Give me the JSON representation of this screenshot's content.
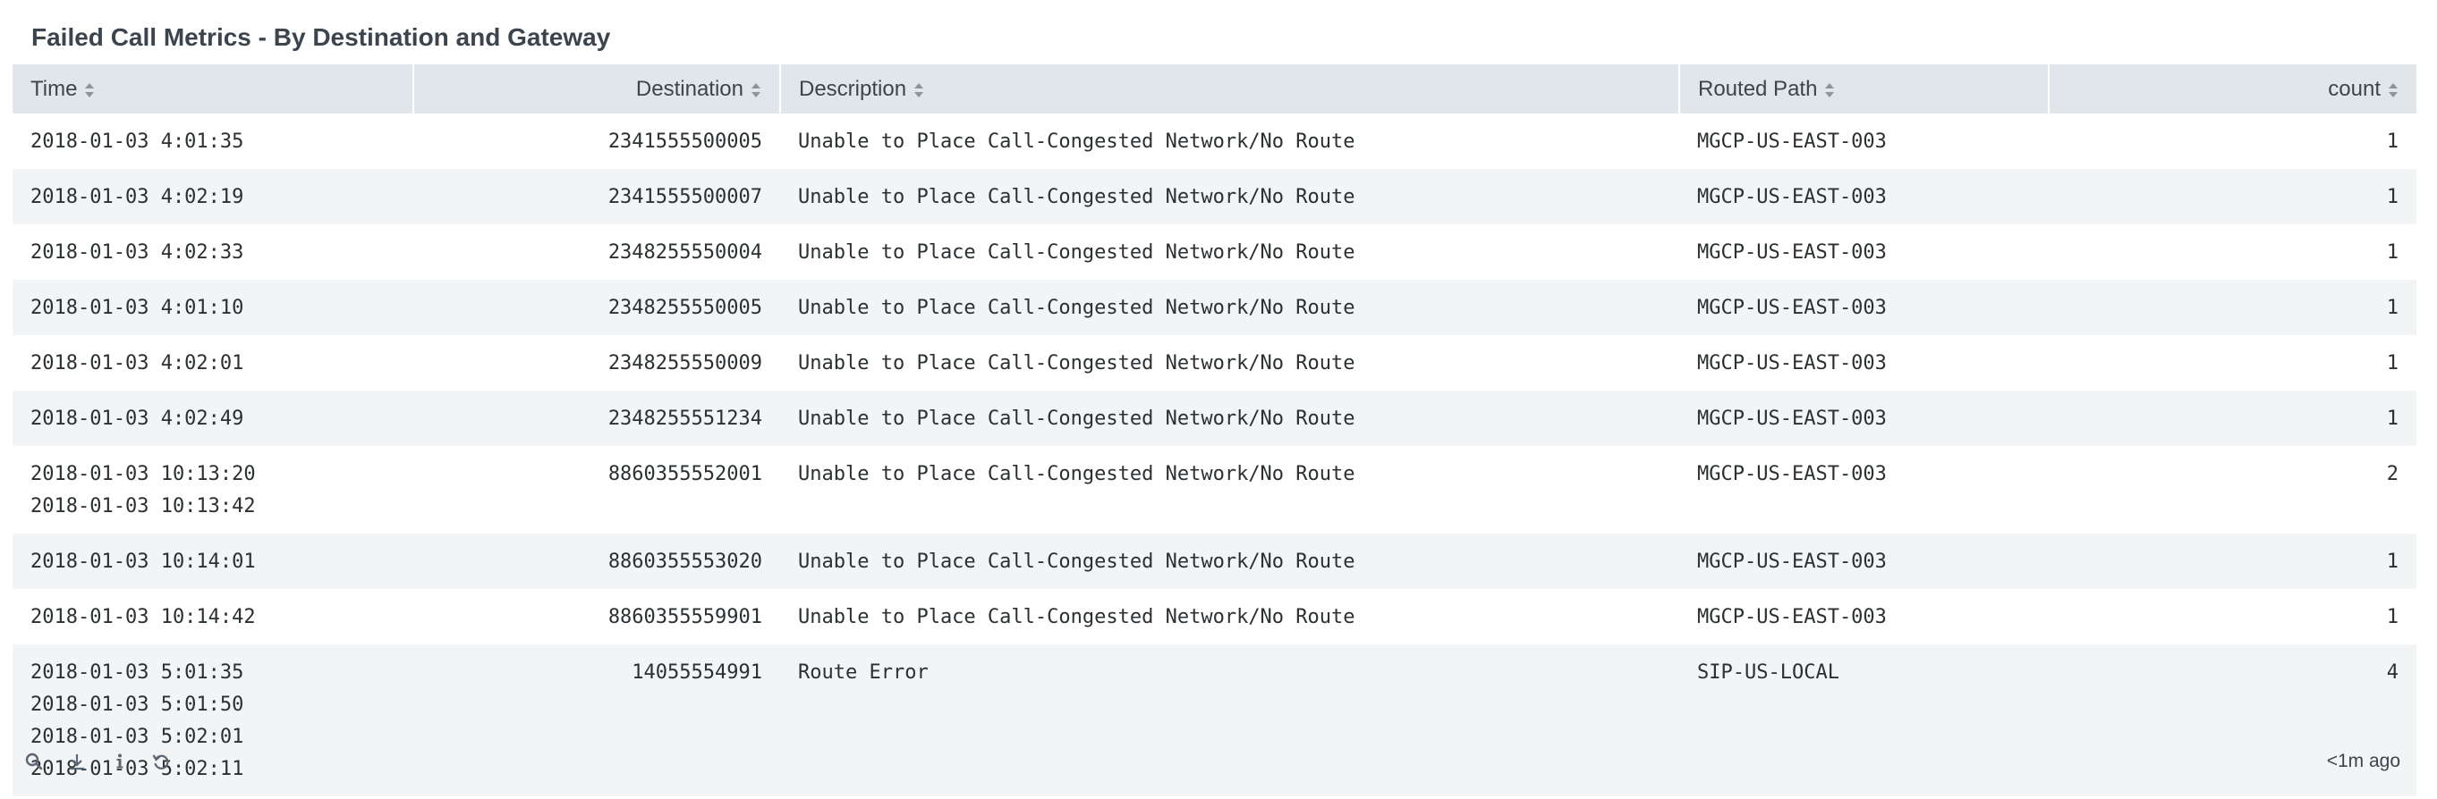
{
  "panel": {
    "title": "Failed Call Metrics - By Destination and Gateway"
  },
  "table": {
    "columns": [
      {
        "key": "time",
        "label": "Time",
        "align": "left"
      },
      {
        "key": "destination",
        "label": "Destination",
        "align": "right"
      },
      {
        "key": "description",
        "label": "Description",
        "align": "left"
      },
      {
        "key": "routed_path",
        "label": "Routed Path",
        "align": "left"
      },
      {
        "key": "count",
        "label": "count",
        "align": "right"
      }
    ],
    "rows": [
      {
        "time": [
          "2018-01-03 4:01:35"
        ],
        "destination": "2341555500005",
        "description": "Unable to Place Call-Congested Network/No Route",
        "routed_path": "MGCP-US-EAST-003",
        "count": "1"
      },
      {
        "time": [
          "2018-01-03 4:02:19"
        ],
        "destination": "2341555500007",
        "description": "Unable to Place Call-Congested Network/No Route",
        "routed_path": "MGCP-US-EAST-003",
        "count": "1"
      },
      {
        "time": [
          "2018-01-03 4:02:33"
        ],
        "destination": "2348255550004",
        "description": "Unable to Place Call-Congested Network/No Route",
        "routed_path": "MGCP-US-EAST-003",
        "count": "1"
      },
      {
        "time": [
          "2018-01-03 4:01:10"
        ],
        "destination": "2348255550005",
        "description": "Unable to Place Call-Congested Network/No Route",
        "routed_path": "MGCP-US-EAST-003",
        "count": "1"
      },
      {
        "time": [
          "2018-01-03 4:02:01"
        ],
        "destination": "2348255550009",
        "description": "Unable to Place Call-Congested Network/No Route",
        "routed_path": "MGCP-US-EAST-003",
        "count": "1"
      },
      {
        "time": [
          "2018-01-03 4:02:49"
        ],
        "destination": "2348255551234",
        "description": "Unable to Place Call-Congested Network/No Route",
        "routed_path": "MGCP-US-EAST-003",
        "count": "1"
      },
      {
        "time": [
          "2018-01-03 10:13:20",
          "2018-01-03 10:13:42"
        ],
        "destination": "8860355552001",
        "description": "Unable to Place Call-Congested Network/No Route",
        "routed_path": "MGCP-US-EAST-003",
        "count": "2"
      },
      {
        "time": [
          "2018-01-03 10:14:01"
        ],
        "destination": "8860355553020",
        "description": "Unable to Place Call-Congested Network/No Route",
        "routed_path": "MGCP-US-EAST-003",
        "count": "1"
      },
      {
        "time": [
          "2018-01-03 10:14:42"
        ],
        "destination": "8860355559901",
        "description": "Unable to Place Call-Congested Network/No Route",
        "routed_path": "MGCP-US-EAST-003",
        "count": "1"
      },
      {
        "time": [
          "2018-01-03 5:01:35",
          "2018-01-03 5:01:50",
          "2018-01-03 5:02:01",
          "2018-01-03 5:02:11"
        ],
        "destination": "14055554991",
        "description": "Route Error",
        "routed_path": "SIP-US-LOCAL",
        "count": "4"
      }
    ]
  },
  "footer": {
    "icons": [
      "search-icon",
      "download-icon",
      "info-icon",
      "refresh-icon"
    ],
    "timestamp": "<1m ago"
  },
  "colors": {
    "header_bg": "#e1e6eb",
    "stripe_bg": "#f2f4f5",
    "text": "#3c444d"
  }
}
